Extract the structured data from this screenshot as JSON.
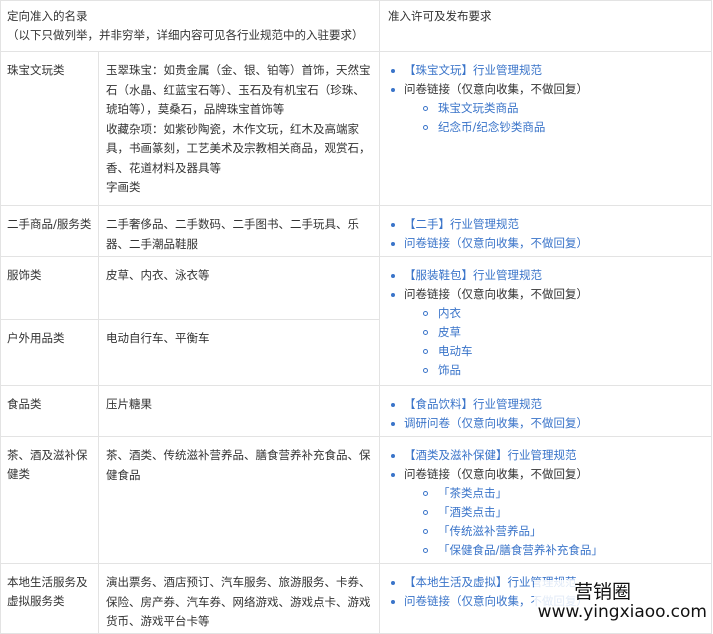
{
  "header": {
    "col1_line1": "定向准入的名录",
    "col1_line2": "（以下只做列举，并非穷举，详细内容可见各行业规范中的入驻要求）",
    "col3": "准入许可及发布要求"
  },
  "rows": {
    "jewelry": {
      "category": "珠宝文玩类",
      "items": [
        "玉翠珠宝：如贵金属（金、银、铂等）首饰，天然宝石（水晶、红蓝宝石等）、玉石及有机宝石（珍珠、琥珀等），莫桑石，品牌珠宝首饰等",
        "收藏杂项：如紫砂陶瓷，木作文玩，红木及高端家具，书画篆刻，工艺美术及宗教相关商品，观赏石，香、花道材料及器具等",
        "字画类"
      ],
      "req": [
        "【珠宝文玩】行业管理规范",
        "问卷链接（仅意向收集，不做回复）"
      ],
      "sub": [
        "珠宝文玩类商品",
        "纪念币/纪念钞类商品"
      ]
    },
    "secondhand": {
      "category": "二手商品/服务类",
      "items": [
        "二手奢侈品、二手数码、二手图书、二手玩具、乐器、二手潮品鞋服"
      ],
      "req": [
        "【二手】行业管理规范",
        "问卷链接（仅意向收集，不做回复）"
      ]
    },
    "apparel": {
      "category": "服饰类",
      "items": [
        "皮草、内衣、泳衣等"
      ],
      "req": [
        "【服装鞋包】行业管理规范",
        "问卷链接（仅意向收集，不做回复）"
      ],
      "sub": [
        "内衣",
        "皮草",
        "电动车",
        "饰品"
      ]
    },
    "outdoor": {
      "category": "户外用品类",
      "items": [
        "电动自行车、平衡车"
      ]
    },
    "food": {
      "category": "食品类",
      "items": [
        "压片糖果"
      ],
      "req": [
        "【食品饮料】行业管理规范",
        "调研问卷（仅意向收集，不做回复）"
      ]
    },
    "tea": {
      "category": "茶、酒及滋补保健类",
      "items": [
        "茶、酒类、传统滋补营养品、膳食营养补充食品、保健食品"
      ],
      "req": [
        "【酒类及滋补保健】行业管理规范",
        "问卷链接（仅意向收集，不做回复）"
      ],
      "sub": [
        "「茶类点击」",
        "「酒类点击」",
        "「传统滋补营养品」",
        "「保健食品/膳食营养补充食品」"
      ]
    },
    "local": {
      "category": "本地生活服务及虚拟服务类",
      "items": [
        "演出票务、酒店预订、汽车服务、旅游服务、卡券、保险、房产券、汽车券、网络游戏、游戏点卡、游戏货币、游戏平台卡等"
      ],
      "req": [
        "【本地生活及虚拟】行业管理规范",
        "问卷链接（仅意向收集，不做回复）"
      ]
    }
  },
  "watermark": {
    "line1": "营销圈",
    "line2": "www.yingxiaoo.com"
  },
  "colors": {
    "link": "#3a74c9",
    "border": "#e3e3e3",
    "text": "#333333"
  }
}
